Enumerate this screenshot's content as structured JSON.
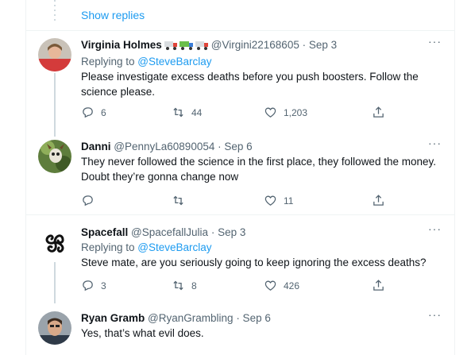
{
  "show_replies": "Show replies",
  "more_glyph": "···",
  "replying_prefix": "Replying to ",
  "tweets": [
    {
      "name": "Virginia Holmes",
      "name_emoji": [
        "delivery-truck",
        "articulated-lorry",
        "delivery-truck"
      ],
      "handle": "@Virgini22168605",
      "date": "· Sep 3",
      "replying_to": "@SteveBarclay",
      "text": "Please investigate excess deaths before you push boosters. Follow the science please.",
      "replies": "6",
      "retweets": "44",
      "likes": "1,203"
    },
    {
      "name": "Danni",
      "handle": "@PennyLa60890054",
      "date": "· Sep 6",
      "text": "They never followed the science in the first place, they followed the money. Doubt they’re gonna change now",
      "replies": "",
      "retweets": "",
      "likes": "11"
    },
    {
      "name": "Spacefall",
      "handle": "@SpacefallJulia",
      "date": "· Sep 3",
      "replying_to": "@SteveBarclay",
      "text": "Steve mate, are you seriously going to keep ignoring the excess deaths?",
      "replies": "3",
      "retweets": "8",
      "likes": "426"
    },
    {
      "name": "Ryan Gramb",
      "handle": "@RyanGrambling",
      "date": "· Sep 6",
      "text": "Yes, that’s what evil does."
    }
  ],
  "colors": {
    "accent": "#1d9bf0",
    "muted": "#536471",
    "text": "#0f1419",
    "border": "#eff3f4"
  }
}
